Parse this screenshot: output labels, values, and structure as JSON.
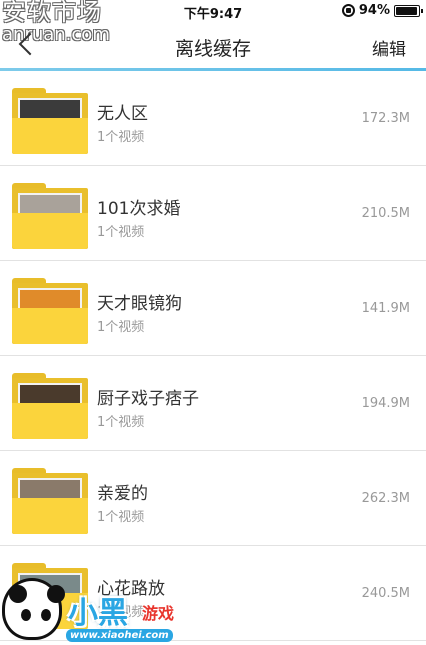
{
  "status_bar": {
    "time": "下午9:47",
    "battery": "94%",
    "battery_level": 0.94
  },
  "watermark_top": {
    "cn": "安软市场",
    "en": "anruan.com"
  },
  "nav": {
    "title": "离线缓存",
    "edit": "编辑",
    "back_icon": "chevron-left-icon"
  },
  "colors": {
    "accent_line": "#55b9e6",
    "folder": "#fbd43c"
  },
  "items": [
    {
      "name": "无人区",
      "sub": "1个视频",
      "size": "172.3M",
      "thumb_color": "#3b3b3b"
    },
    {
      "name": "101次求婚",
      "sub": "1个视频",
      "size": "210.5M",
      "thumb_color": "#a9a29a"
    },
    {
      "name": "天才眼镜狗",
      "sub": "1个视频",
      "size": "141.9M",
      "thumb_color": "#e08b2a"
    },
    {
      "name": "厨子戏子痞子",
      "sub": "1个视频",
      "size": "194.9M",
      "thumb_color": "#4a3a2c"
    },
    {
      "name": "亲爱的",
      "sub": "1个视频",
      "size": "262.3M",
      "thumb_color": "#8a7a6a"
    },
    {
      "name": "心花路放",
      "sub": "1个视频",
      "size": "240.5M",
      "thumb_color": "#7a8a8a"
    }
  ],
  "logo": {
    "big": "小黑",
    "small": "游戏",
    "url": "www.xiaohei.com"
  }
}
